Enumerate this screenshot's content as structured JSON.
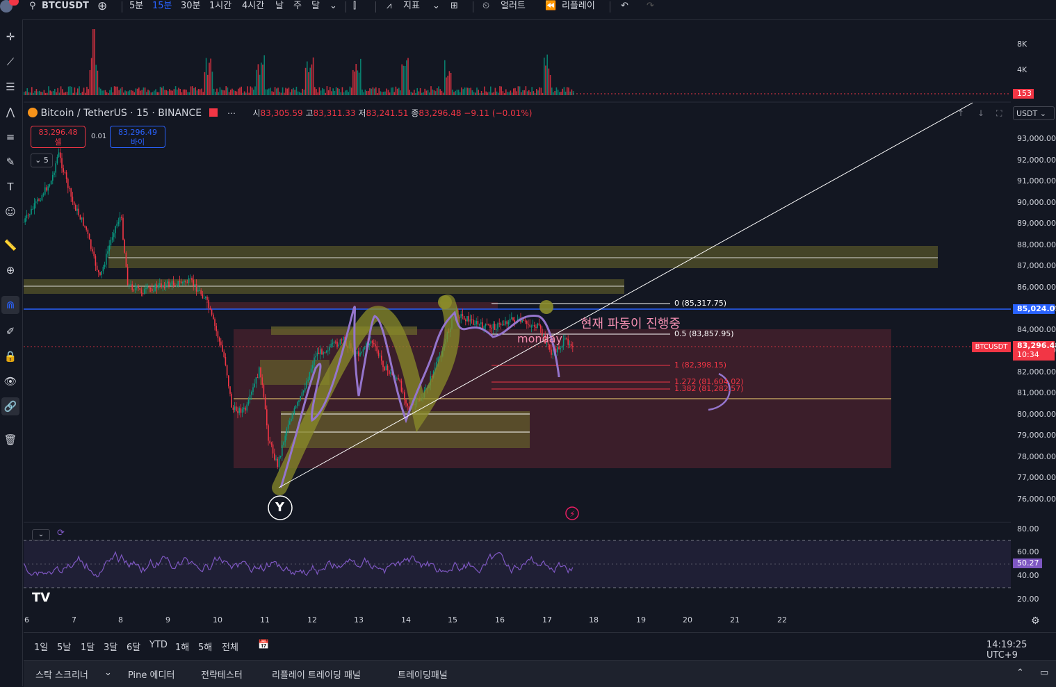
{
  "topbar": {
    "symbol": "BTCUSDT",
    "intervals": [
      "5분",
      "15분",
      "30분",
      "1시간",
      "4시간",
      "날",
      "주",
      "달"
    ],
    "active_interval": "15분",
    "indicators_label": "지표",
    "alert_label": "얼러트",
    "replay_label": "리플레이"
  },
  "legend": {
    "title": "Bitcoin / TetherUS · 15 · BINANCE",
    "open_k": "시",
    "open_v": "83,305.59",
    "high_k": "고",
    "high_v": "83,311.33",
    "low_k": "저",
    "low_v": "83,241.51",
    "close_k": "종",
    "close_v": "83,296.48",
    "change": "−9.11 (−0.01%)"
  },
  "trade": {
    "sell_price": "83,296.48",
    "sell_label": "셀",
    "spread": "0.01",
    "buy_price": "83,296.49",
    "buy_label": "바이",
    "collapse_count": "5"
  },
  "volume_axis": {
    "labels": [
      "8K",
      "4K"
    ],
    "current": "153"
  },
  "price_axis": {
    "currency": "USDT",
    "labels": [
      "93,000.00",
      "92,000.00",
      "91,000.00",
      "90,000.00",
      "89,000.00",
      "88,000.00",
      "87,000.00",
      "86,000.00",
      "85,000.00",
      "84,000.00",
      "83,000.00",
      "82,000.00",
      "81,000.00",
      "80,000.00",
      "79,000.00",
      "78,000.00",
      "77,000.00",
      "76,000.00"
    ],
    "blue_line_tag": "85,024.01",
    "symbol_tag": "BTCUSDT",
    "price_tag": "83,296.48",
    "countdown": "10:34"
  },
  "rsi_axis": {
    "labels": [
      "80.00",
      "60.00",
      "40.00",
      "20.00"
    ],
    "current": "50.27"
  },
  "x_axis": {
    "labels": [
      "6",
      "7",
      "8",
      "9",
      "10",
      "11",
      "12",
      "13",
      "14",
      "15",
      "16",
      "17",
      "18",
      "19",
      "20",
      "21",
      "22"
    ]
  },
  "fib": {
    "l0": "0 (85,317.75)",
    "l05": "0.5 (83,857.95)",
    "l1": "1 (82,398.15)",
    "l1272": "1.272 (81,604.02)",
    "l1382": "1.382 (81,282.57)"
  },
  "annotations": {
    "korean": "현재 파동이 진행중",
    "monday": "monday",
    "wave_label": "Y"
  },
  "bottombar": {
    "ranges": [
      "1일",
      "5날",
      "1달",
      "3달",
      "6달",
      "YTD",
      "1해",
      "5해",
      "전체"
    ],
    "clock": "14:19:25 UTC+9"
  },
  "panelbar": {
    "tabs": [
      "스탁 스크리너",
      "Pine 에디터",
      "전략테스터",
      "리플레이 트레이딩 패널",
      "트레이딩패널"
    ]
  },
  "colors": {
    "bg": "#131722",
    "up": "#089981",
    "down": "#f23645",
    "blue": "#2962ff",
    "purple": "#9575cd",
    "zone_yellow": "#6d6a2c",
    "zone_red": "#5c2431"
  }
}
